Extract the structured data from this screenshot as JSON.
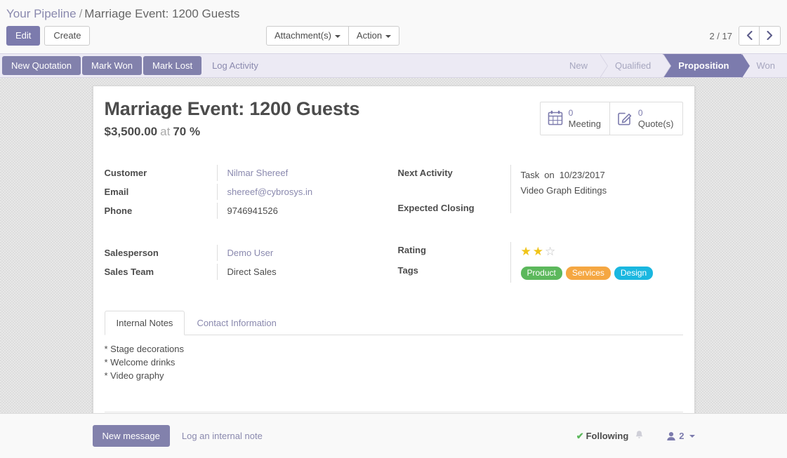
{
  "breadcrumb": {
    "root": "Your Pipeline",
    "separator": "/",
    "current": "Marriage Event: 1200 Guests"
  },
  "toolbar": {
    "edit_label": "Edit",
    "create_label": "Create",
    "attachments_label": "Attachment(s)",
    "action_label": "Action"
  },
  "pager": {
    "count": "2 / 17",
    "prev_icon": "chevron-left-icon",
    "next_icon": "chevron-right-icon",
    "prev_glyph": "‹",
    "next_glyph": "›"
  },
  "statusbar": {
    "buttons": [
      {
        "label": "New Quotation",
        "style": "primary"
      },
      {
        "label": "Mark Won",
        "style": "primary"
      },
      {
        "label": "Mark Lost",
        "style": "primary"
      },
      {
        "label": "Log Activity",
        "style": "link"
      }
    ],
    "stages": [
      {
        "label": "New",
        "active": false
      },
      {
        "label": "Qualified",
        "active": false
      },
      {
        "label": "Proposition",
        "active": true
      },
      {
        "label": "Won",
        "active": false
      }
    ],
    "active_color": "#7c7bad"
  },
  "record": {
    "title": "Marriage Event: 1200 Guests",
    "amount": "$3,500.00",
    "at_label": "at",
    "probability": "70 %"
  },
  "stats": [
    {
      "count": "0",
      "label": "Meeting",
      "icon": "calendar-icon"
    },
    {
      "count": "0",
      "label": "Quote(s)",
      "icon": "pencil-square-icon"
    }
  ],
  "fields": {
    "left": [
      {
        "label": "Customer",
        "value": "Nilmar Shereef",
        "link": true
      },
      {
        "label": "Email",
        "value": "shereef@cybrosys.in",
        "link": true
      },
      {
        "label": "Phone",
        "value": "9746941526",
        "link": false
      },
      {
        "label": "Salesperson",
        "value": "Demo User",
        "link": true
      },
      {
        "label": "Sales Team",
        "value": "Direct Sales",
        "link": false
      }
    ],
    "right": {
      "next_activity_label": "Next Activity",
      "next_activity_type": "Task",
      "next_activity_on": "on",
      "next_activity_date": "10/23/2017",
      "next_activity_summary": "Video Graph Editings",
      "expected_closing_label": "Expected Closing",
      "expected_closing_value": "",
      "rating_label": "Rating",
      "rating_filled": 2,
      "rating_total": 3,
      "tags_label": "Tags"
    }
  },
  "tags": [
    {
      "name": "Product",
      "color": "#5cb85c"
    },
    {
      "name": "Services",
      "color": "#f5a councilman"
    },
    {
      "name": "Design",
      "color": "#1ab7e0"
    }
  ],
  "tags_fixed": [
    {
      "name": "Product",
      "color": "#5cb85c"
    },
    {
      "name": "Services",
      "color": "#f5a742"
    },
    {
      "name": "Design",
      "color": "#1ab7e0"
    }
  ],
  "notebook": {
    "tabs": [
      {
        "label": "Internal Notes",
        "active": true
      },
      {
        "label": "Contact Information",
        "active": false
      }
    ],
    "notes": [
      "* Stage decorations",
      "* Welcome drinks",
      "* Video graphy"
    ]
  },
  "chatter": {
    "new_message_label": "New message",
    "log_note_label": "Log an internal note",
    "following_label": "Following",
    "following_check": "✔",
    "bell_icon": "bell-icon",
    "follower_icon": "user-icon",
    "follower_count": "2"
  }
}
